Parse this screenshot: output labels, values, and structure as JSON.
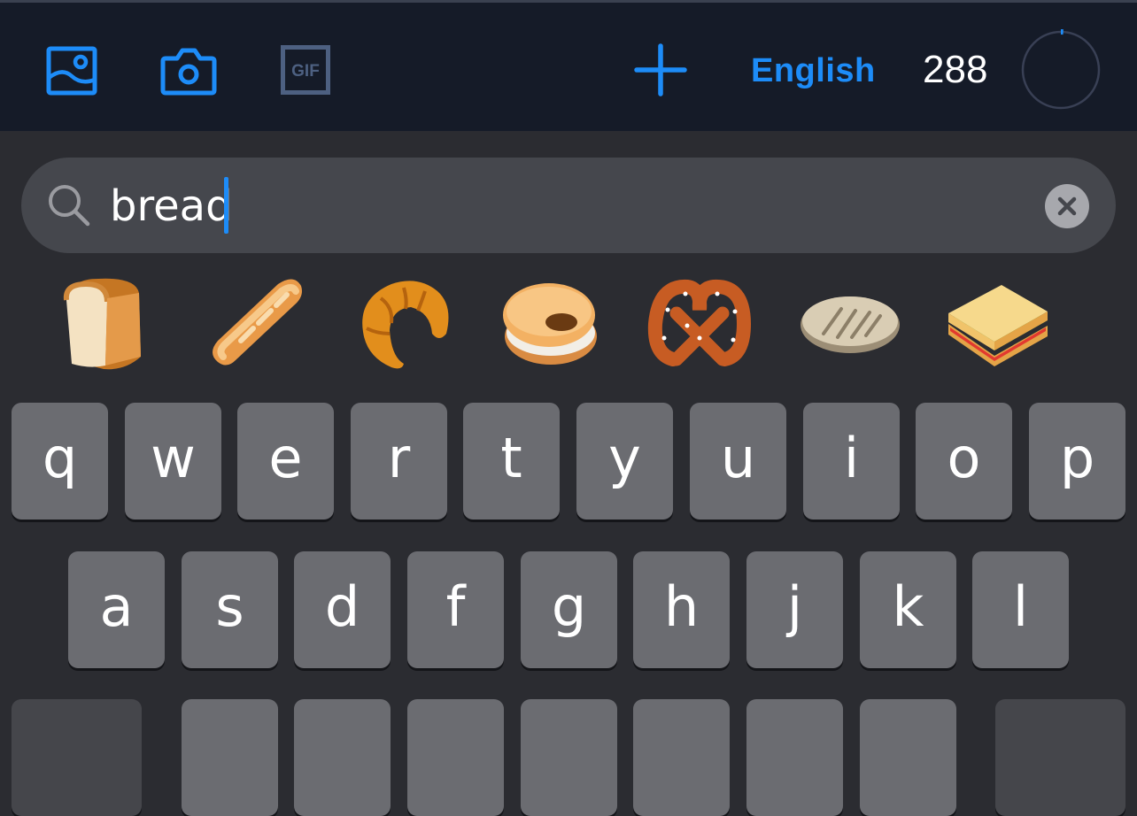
{
  "toolbar": {
    "icons": [
      "image-icon",
      "camera-icon",
      "gif-icon",
      "add-icon"
    ],
    "gif_label": "GIF",
    "language": "English",
    "character_count": "288",
    "progress_fraction": 0.01,
    "accent_color": "#1d8cf8"
  },
  "search": {
    "value": "bread",
    "icons": [
      "search-icon",
      "clear-icon"
    ]
  },
  "emoji_results": [
    {
      "name": "bread-emoji"
    },
    {
      "name": "baguette-emoji"
    },
    {
      "name": "croissant-emoji"
    },
    {
      "name": "bagel-emoji"
    },
    {
      "name": "pretzel-emoji"
    },
    {
      "name": "flatbread-emoji"
    },
    {
      "name": "sandwich-emoji"
    }
  ],
  "keyboard": {
    "row1": [
      "q",
      "w",
      "e",
      "r",
      "t",
      "y",
      "u",
      "i",
      "o",
      "p"
    ],
    "row2": [
      "a",
      "s",
      "d",
      "f",
      "g",
      "h",
      "j",
      "k",
      "l"
    ]
  }
}
